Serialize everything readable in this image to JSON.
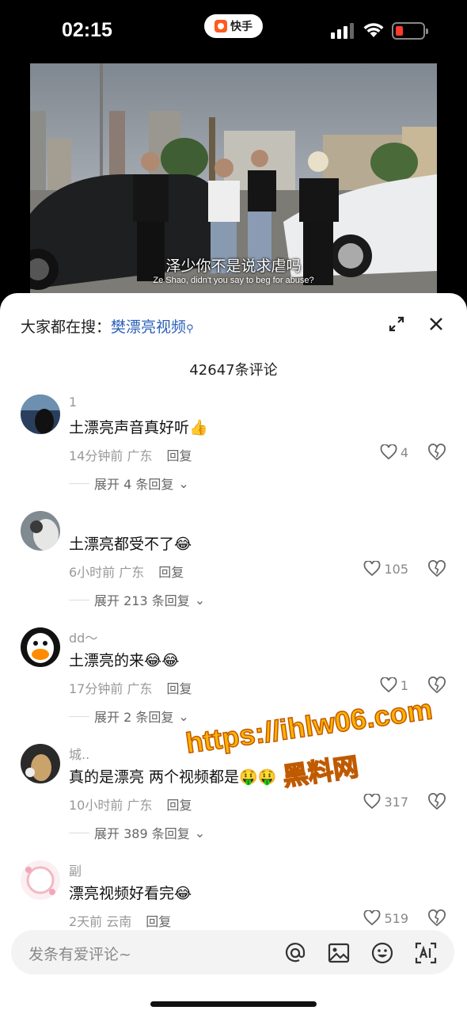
{
  "status": {
    "time": "02:15",
    "app_pill": "快手"
  },
  "video": {
    "subtitle_cn": "泽少你不是说求虐吗",
    "subtitle_en": "Ze Shao, didn't you say to beg for abuse?"
  },
  "sheet": {
    "search_prefix": "大家都在搜：",
    "search_term": "樊漂亮视频",
    "comment_count": "42647条评论"
  },
  "comments": [
    {
      "name": "1",
      "text": "土漂亮声音真好听👍",
      "time": "14分钟前",
      "region": "广东",
      "reply": "回复",
      "likes": "4",
      "expand": "展开 4 条回复"
    },
    {
      "name": "",
      "text": "土漂亮都受不了😂",
      "time": "6小时前",
      "region": "广东",
      "reply": "回复",
      "likes": "105",
      "expand": "展开 213 条回复"
    },
    {
      "name": "dd～",
      "text": "土漂亮的来😂😂",
      "time": "17分钟前",
      "region": "广东",
      "reply": "回复",
      "likes": "1",
      "expand": "展开 2 条回复"
    },
    {
      "name": "城..",
      "text": "真的是漂亮 两个视频都是🤑🤑",
      "time": "10小时前",
      "region": "广东",
      "reply": "回复",
      "likes": "317",
      "expand": "展开 389 条回复"
    },
    {
      "name": "副",
      "text": "漂亮视频好看完😂",
      "time": "2天前",
      "region": "云南",
      "reply": "回复",
      "likes": "519",
      "expand": ""
    }
  ],
  "watermark": {
    "url": "https://ihlw06.com",
    "label": "黑料网"
  },
  "input": {
    "placeholder": "发条有爱评论~"
  },
  "colors": {
    "accent_link": "#2b5fb8",
    "battery_low": "#ff3b30",
    "watermark": "#ffb300"
  }
}
